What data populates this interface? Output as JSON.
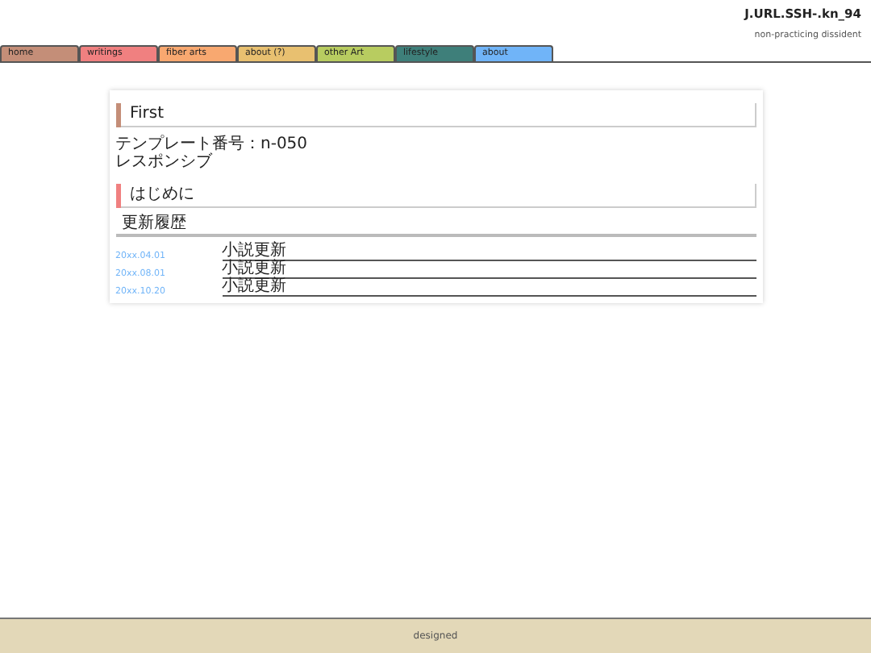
{
  "site": {
    "title": "J.URL.SSH-.kn_94",
    "subtitle": "non-practicing dissident"
  },
  "nav": [
    {
      "label": "home",
      "color": "#c48e78"
    },
    {
      "label": "writings",
      "color": "#f08080"
    },
    {
      "label": "fiber arts",
      "color": "#f8a870"
    },
    {
      "label": "about (?)",
      "color": "#e8c070"
    },
    {
      "label": "other Art",
      "color": "#b8cc60"
    },
    {
      "label": "lifestyle",
      "color": "#3e7f7a"
    },
    {
      "label": "about",
      "color": "#70b4f8"
    }
  ],
  "sections": [
    {
      "heading": "First",
      "color": "#c48e78",
      "lines": [
        "テンプレート番号：n-050",
        "レスポンシブ"
      ]
    },
    {
      "heading": "はじめに",
      "color": "#f08080"
    }
  ],
  "updates": {
    "title": "更新履歴",
    "rows": [
      {
        "date": "20xx.04.01",
        "text": "小説更新"
      },
      {
        "date": "20xx.08.01",
        "text": "小説更新"
      },
      {
        "date": "20xx.10.20",
        "text": "小説更新"
      }
    ]
  },
  "footer": "designed"
}
